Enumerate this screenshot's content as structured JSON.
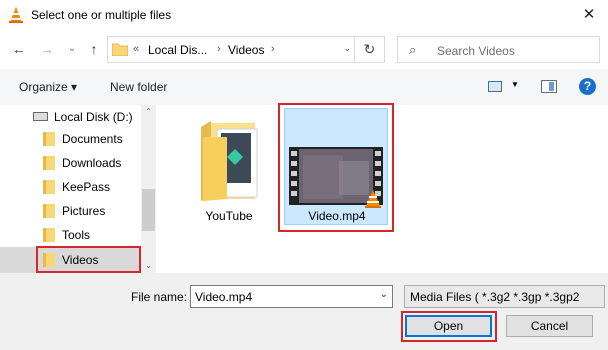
{
  "window": {
    "title": "Select one or multiple files",
    "close_glyph": "✕"
  },
  "nav": {
    "back_glyph": "←",
    "forward_glyph": "→",
    "recent_glyph": "⌄",
    "up_glyph": "↑",
    "path_sep_lead": "«",
    "breadcrumbs": [
      "Local Dis...",
      "Videos"
    ],
    "path_sep": "›",
    "dropdown_glyph": "⌄",
    "refresh_glyph": "↻"
  },
  "search": {
    "placeholder": "Search Videos",
    "icon_glyph": "⌕"
  },
  "toolbar": {
    "organize_label": "Organize ▾",
    "new_folder_label": "New folder",
    "help_glyph": "?"
  },
  "sidebar": {
    "drive_label": "Local Disk (D:)",
    "items": [
      "Documents",
      "Downloads",
      "KeePass",
      "Pictures",
      "Tools",
      "Videos"
    ],
    "selected": "Videos",
    "scroll_up_glyph": "⌃",
    "scroll_down_glyph": "⌄"
  },
  "files": [
    {
      "name": "YouTube",
      "type": "folder"
    },
    {
      "name": "Video.mp4",
      "type": "video",
      "selected": true
    }
  ],
  "footer": {
    "file_name_label": "File name:",
    "file_name_value": "Video.mp4",
    "file_type_value": "Media Files ( *.3g2 *.3gp *.3gp2",
    "open_label": "Open",
    "cancel_label": "Cancel",
    "dropdown_glyph": "⌄"
  },
  "colors": {
    "highlight_box": "#d6262b",
    "selected_tile": "#cce8ff",
    "folder": "#f8d775",
    "accent": "#0078d7"
  }
}
